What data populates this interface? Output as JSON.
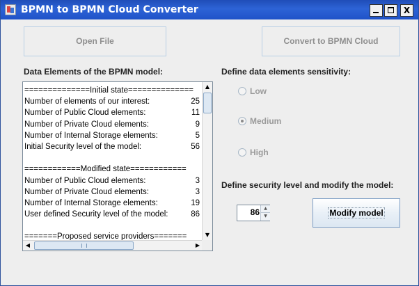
{
  "window": {
    "title": "BPMN to BPMN Cloud Converter",
    "controls": {
      "minimize": "",
      "maximize": "",
      "close": "X"
    }
  },
  "toolbar": {
    "open_file": "Open File",
    "convert": "Convert to BPMN Cloud"
  },
  "labels": {
    "data_elements": "Data Elements of the BPMN model:",
    "sensitivity": "Define data elements sensitivity:",
    "security_level": "Define security level and modify the model:"
  },
  "report": {
    "lines": [
      {
        "text": "==============Initial state==============",
        "value": ""
      },
      {
        "text": "Number of elements of our interest:",
        "value": "25"
      },
      {
        "text": "Number of Public Cloud elements:",
        "value": "11"
      },
      {
        "text": "Number of Private Cloud elements:",
        "value": "9"
      },
      {
        "text": "Number of Internal Storage elements:",
        "value": "5"
      },
      {
        "text": "Initial Security level of the model:",
        "value": "56"
      },
      {
        "text": "",
        "value": ""
      },
      {
        "text": "============Modified state============",
        "value": ""
      },
      {
        "text": "Number of Public Cloud elements:",
        "value": "3"
      },
      {
        "text": "Number of Private Cloud elements:",
        "value": "3"
      },
      {
        "text": "Number of Internal Storage elements:",
        "value": "19"
      },
      {
        "text": "User defined Security level of the model:",
        "value": "86"
      },
      {
        "text": "",
        "value": ""
      },
      {
        "text": "=======Proposed service providers=======",
        "value": ""
      }
    ]
  },
  "sensitivity": {
    "options": [
      "Low",
      "Medium",
      "High"
    ],
    "selected": "Medium"
  },
  "security_level": {
    "value": "86"
  },
  "actions": {
    "modify": "Modify model"
  },
  "colors": {
    "titlebar": "#2d63d6",
    "disabled_text": "#8e8e8e",
    "window_bg": "#eeeeee"
  }
}
